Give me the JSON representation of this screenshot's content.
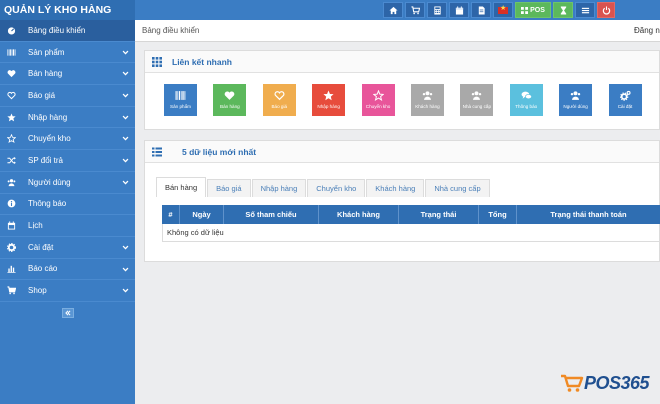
{
  "app": {
    "title": "QUẢN LÝ KHO HÀNG"
  },
  "toolbar": {
    "pos_label": "POS",
    "buttons": [
      "home-icon",
      "cart-icon",
      "calculator-icon",
      "calendar-icon",
      "document-icon",
      "flag-vn-icon",
      "pos-button",
      "hourglass-icon",
      "list-icon",
      "power-icon"
    ]
  },
  "sidebar": {
    "items": [
      {
        "label": "Bảng điều khiển",
        "icon": "dashboard-icon"
      },
      {
        "label": "Sản phẩm",
        "icon": "barcode-icon"
      },
      {
        "label": "Bán hàng",
        "icon": "heart-icon"
      },
      {
        "label": "Báo giá",
        "icon": "heart-outline-icon"
      },
      {
        "label": "Nhập hàng",
        "icon": "star-icon"
      },
      {
        "label": "Chuyển kho",
        "icon": "star-outline-icon"
      },
      {
        "label": "SP đổi trả",
        "icon": "random-icon"
      },
      {
        "label": "Người dùng",
        "icon": "users-icon"
      },
      {
        "label": "Thông báo",
        "icon": "info-icon"
      },
      {
        "label": "Lịch",
        "icon": "calendar-icon"
      },
      {
        "label": "Cài đặt",
        "icon": "cog-icon"
      },
      {
        "label": "Báo cáo",
        "icon": "bar-chart-icon"
      },
      {
        "label": "Shop",
        "icon": "cart-icon"
      }
    ]
  },
  "breadcrumb": {
    "current": "Bảng điều khiển"
  },
  "header": {
    "login": "Đăng nh"
  },
  "quick_links": {
    "title": "Liên kết nhanh",
    "tiles": [
      {
        "label": "Sản phẩm",
        "color": "#3b7dc4",
        "icon": "barcode-icon"
      },
      {
        "label": "Bán hàng",
        "color": "#5cb85c",
        "icon": "heart-icon"
      },
      {
        "label": "Báo giá",
        "color": "#f0ad4e",
        "icon": "heart-outline-icon"
      },
      {
        "label": "Nhập hàng",
        "color": "#e74c3c",
        "icon": "star-icon"
      },
      {
        "label": "Chuyển kho",
        "color": "#e8559a",
        "icon": "star-outline-icon"
      },
      {
        "label": "Khách hàng",
        "color": "#a9a9a9",
        "icon": "users-icon"
      },
      {
        "label": "Nhà cung cấp",
        "color": "#a9a9a9",
        "icon": "users-icon"
      },
      {
        "label": "Thông báo",
        "color": "#5bc0de",
        "icon": "comments-icon"
      },
      {
        "label": "Người dùng",
        "color": "#3b7dc4",
        "icon": "users-icon"
      },
      {
        "label": "Cài đặt",
        "color": "#3b7dc4",
        "icon": "cogs-icon"
      }
    ]
  },
  "latest": {
    "title": "5 dữ liệu mới nhất",
    "tabs": [
      "Bán hàng",
      "Báo giá",
      "Nhập hàng",
      "Chuyển kho",
      "Khách hàng",
      "Nhà cung cấp"
    ],
    "columns": [
      "#",
      "Ngày",
      "Số tham chiếu",
      "Khách hàng",
      "Trạng thái",
      "Tổng",
      "Trạng thái thanh toán"
    ],
    "empty_text": "Không có dữ liệu"
  },
  "logo": {
    "text": "POS365"
  },
  "colors": {
    "primary": "#3b7dc4",
    "sidebar_active": "#2a5f9e",
    "header_dark": "#2f6eb2",
    "success": "#5cb85c",
    "danger": "#d9534f"
  }
}
